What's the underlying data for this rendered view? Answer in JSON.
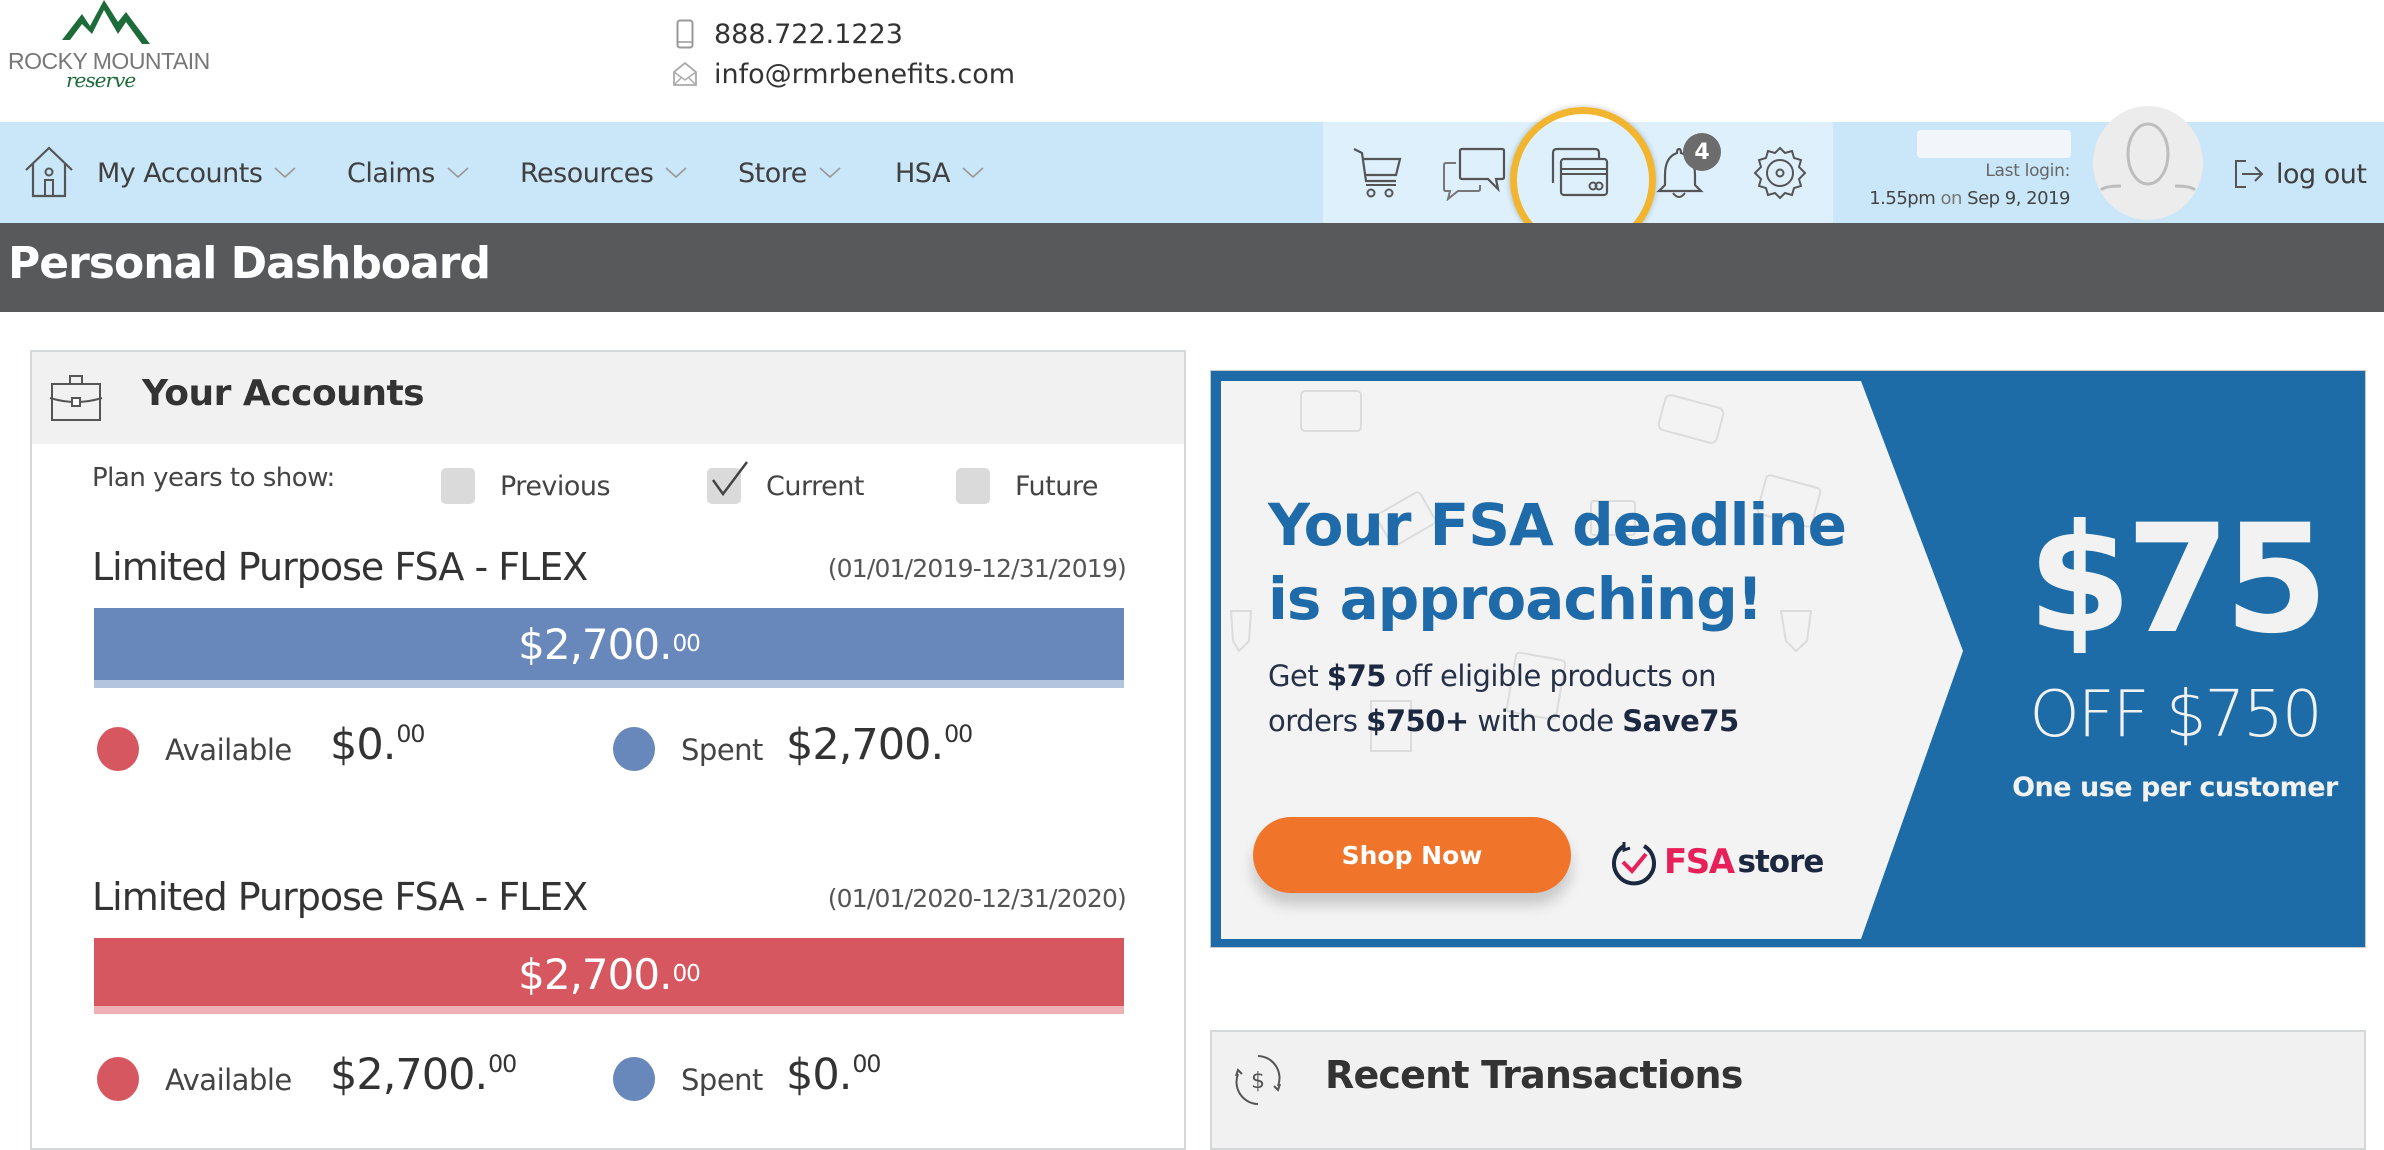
{
  "brand": {
    "name_line1": "ROCKY MOUNTAIN",
    "name_line2": "reserve"
  },
  "contact": {
    "phone": "888.722.1223",
    "email": "info@rmrbenefits.com"
  },
  "nav": {
    "items": [
      {
        "label": "My Accounts"
      },
      {
        "label": "Claims"
      },
      {
        "label": "Resources"
      },
      {
        "label": "Store"
      },
      {
        "label": "HSA"
      }
    ],
    "icons": {
      "cart": "cart-icon",
      "messages": "chat-bubbles-icon",
      "cards": "credit-cards-icon",
      "notifications": "bell-icon",
      "settings": "gear-icon"
    },
    "notification_count": "4",
    "highlight_color": "#f2b52f"
  },
  "user": {
    "last_login_label": "Last login:",
    "last_login_time": "1.55pm",
    "last_login_on": "on",
    "last_login_date": "Sep 9, 2019",
    "logout_label": "log out"
  },
  "page": {
    "title": "Personal Dashboard"
  },
  "accounts": {
    "title": "Your Accounts",
    "plan_years_label": "Plan years to show:",
    "plan_years": [
      {
        "label": "Previous",
        "checked": false
      },
      {
        "label": "Current",
        "checked": true
      },
      {
        "label": "Future",
        "checked": false
      }
    ],
    "items": [
      {
        "name": "Limited Purpose FSA - FLEX",
        "dates": "(01/01/2019-12/31/2019)",
        "total_whole": "$2,700.",
        "total_cents": "00",
        "bar_color": "#6887bb",
        "bar_under_color": "#b3c5de",
        "available_label": "Available",
        "available_whole": "$0.",
        "available_cents": "00",
        "spent_label": "Spent",
        "spent_whole": "$2,700.",
        "spent_cents": "00"
      },
      {
        "name": "Limited Purpose FSA - FLEX",
        "dates": "(01/01/2020-12/31/2020)",
        "total_whole": "$2,700.",
        "total_cents": "00",
        "bar_color": "#d6575f",
        "bar_under_color": "#eeb0b4",
        "available_label": "Available",
        "available_whole": "$2,700.",
        "available_cents": "00",
        "spent_label": "Spent",
        "spent_whole": "$0.",
        "spent_cents": "00"
      }
    ],
    "colors": {
      "available": "#d6575f",
      "spent": "#6887bb"
    }
  },
  "ad": {
    "headline_line1": "Your FSA deadline",
    "headline_line2": "is approaching!",
    "body_get": "Get",
    "body_amount": "$75",
    "body_rest1": "off eligible products on",
    "body_orders": "orders",
    "body_min": "$750+",
    "body_with_code": "with code",
    "body_code": "Save75",
    "cta": "Shop Now",
    "logo_fsa": "FSA",
    "logo_store": "store",
    "big_amount": "$75",
    "off_text": "OFF $750",
    "limit_text": "One use per customer",
    "brand_blue": "#1d6ca8",
    "cta_color": "#f0752a"
  },
  "transactions": {
    "title": "Recent Transactions"
  }
}
